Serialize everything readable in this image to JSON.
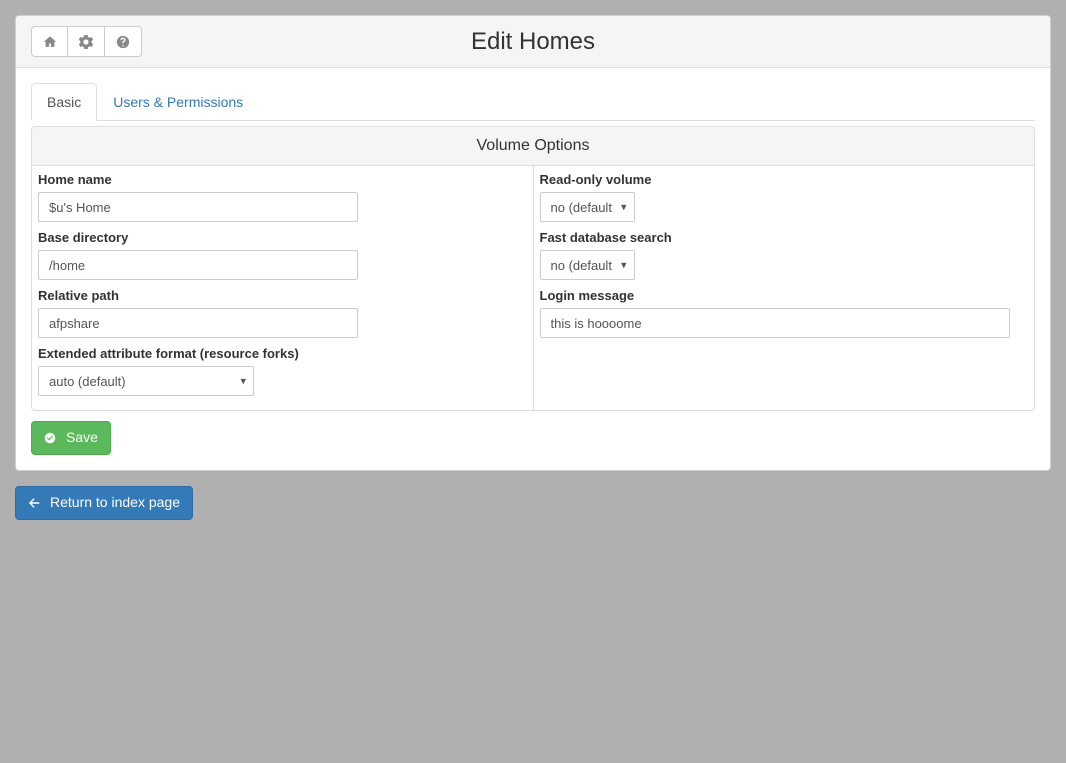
{
  "header": {
    "title": "Edit Homes"
  },
  "tabs": [
    {
      "label": "Basic",
      "active": true
    },
    {
      "label": "Users & Permissions",
      "active": false
    }
  ],
  "volume_panel": {
    "heading": "Volume Options",
    "left": {
      "home_name": {
        "label": "Home name",
        "value": "$u's Home"
      },
      "base_dir": {
        "label": "Base directory",
        "value": "/home"
      },
      "rel_path": {
        "label": "Relative path",
        "value": "afpshare"
      },
      "xattr": {
        "label": "Extended attribute format (resource forks)",
        "value": "auto (default)"
      }
    },
    "right": {
      "readonly": {
        "label": "Read-only volume",
        "value": "no (default)"
      },
      "fast_db": {
        "label": "Fast database search",
        "value": "no (default)"
      },
      "login_msg": {
        "label": "Login message",
        "value": "this is hoooome"
      }
    }
  },
  "buttons": {
    "save": "Save",
    "return": "Return to index page"
  }
}
